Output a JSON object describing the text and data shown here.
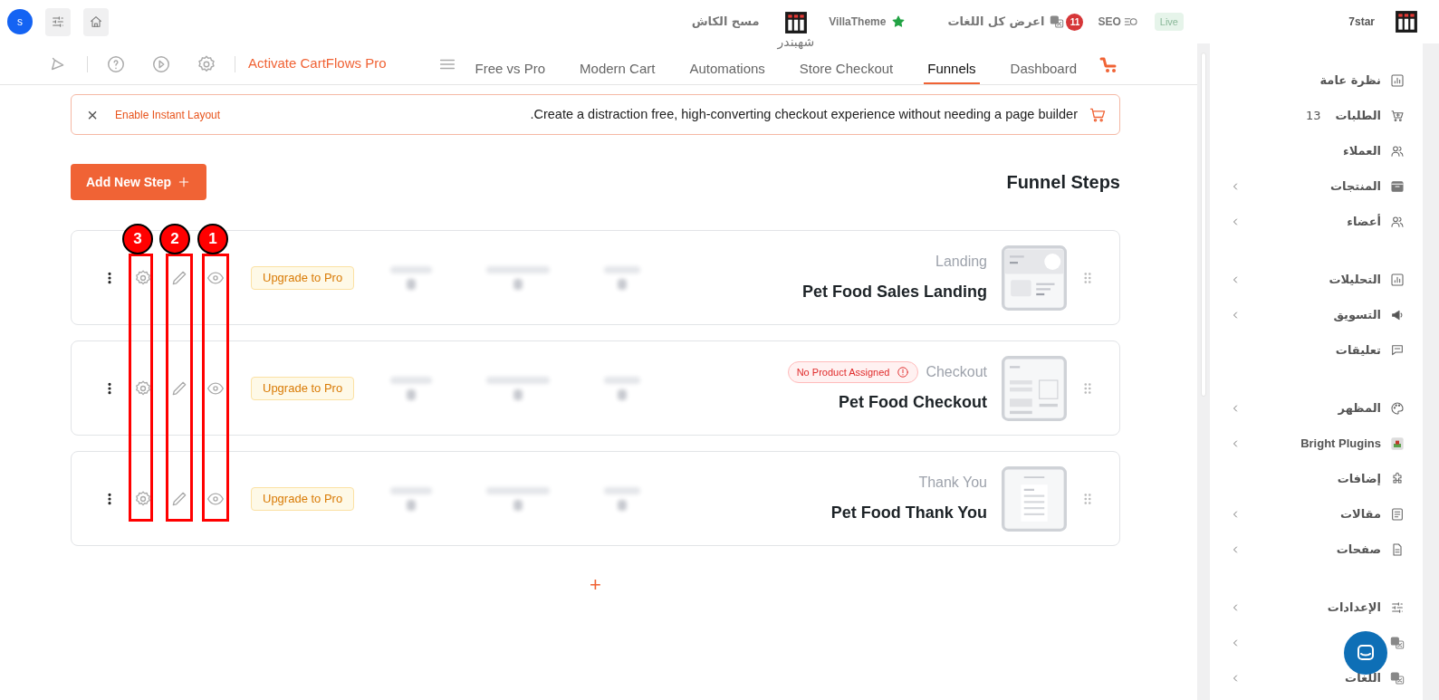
{
  "admin_bar": {
    "avatar": "s",
    "items": [
      {
        "kind": "live",
        "label": "Live"
      },
      {
        "kind": "seo",
        "label": "SEO"
      },
      {
        "kind": "badge",
        "label": "11"
      },
      {
        "kind": "translate",
        "label": "اعرض كل اللغات"
      },
      {
        "kind": "star",
        "label": "VillaTheme"
      },
      {
        "kind": "logo",
        "label": "شهبندر"
      },
      {
        "kind": "text",
        "label": "مسح الكاش"
      }
    ],
    "site": "7star"
  },
  "nav": {
    "activate": "Activate CartFlows Pro",
    "tabs": [
      {
        "label": "Dashboard",
        "selected": false
      },
      {
        "label": "Funnels",
        "selected": true
      },
      {
        "label": "Store Checkout",
        "selected": false
      },
      {
        "label": "Automations",
        "selected": false
      },
      {
        "label": "Modern Cart",
        "selected": false
      },
      {
        "label": "Free vs Pro",
        "selected": false
      }
    ]
  },
  "notice": {
    "message": ".Create a distraction free, high-converting checkout experience without needing a page builder",
    "action": "Enable Instant Layout",
    "close": "×"
  },
  "heading": "Funnel Steps",
  "add_button": "Add New Step",
  "steps": [
    {
      "kind": "landing",
      "type": "Landing",
      "title": "Pet Food Sales Landing",
      "upgrade": "Upgrade to Pro"
    },
    {
      "kind": "checkout",
      "type": "Checkout",
      "title": "Pet Food Checkout",
      "badge": "No Product Assigned",
      "upgrade": "Upgrade to Pro"
    },
    {
      "kind": "thankyou",
      "type": "Thank You",
      "title": "Pet Food Thank You",
      "upgrade": "Upgrade to Pro"
    }
  ],
  "add_step_plus": "+",
  "annotations": [
    {
      "label": "1"
    },
    {
      "label": "2"
    },
    {
      "label": "3"
    }
  ],
  "sidebar": {
    "groups": [
      [
        {
          "label": "نظرة عامة",
          "expandable": false
        },
        {
          "label": "الطلبات",
          "count": "13",
          "expandable": false
        },
        {
          "label": "العملاء",
          "expandable": false
        },
        {
          "label": "المنتجات",
          "expandable": true
        },
        {
          "label": "أعضاء",
          "expandable": true
        }
      ],
      [
        {
          "label": "التحليلات",
          "expandable": true
        },
        {
          "label": "التسويق",
          "expandable": true
        },
        {
          "label": "تعليقات",
          "expandable": false
        }
      ],
      [
        {
          "label": "المظهر",
          "expandable": true
        },
        {
          "label": "Bright Plugins",
          "expandable": true
        },
        {
          "label": "إضافات",
          "expandable": false
        },
        {
          "label": "مقالات",
          "expandable": true
        },
        {
          "label": "صفحات",
          "expandable": true
        }
      ],
      [
        {
          "label": "الإعدادات",
          "expandable": true
        },
        {
          "expandable": true
        },
        {
          "label": "اللغات",
          "expandable": true
        }
      ]
    ]
  }
}
